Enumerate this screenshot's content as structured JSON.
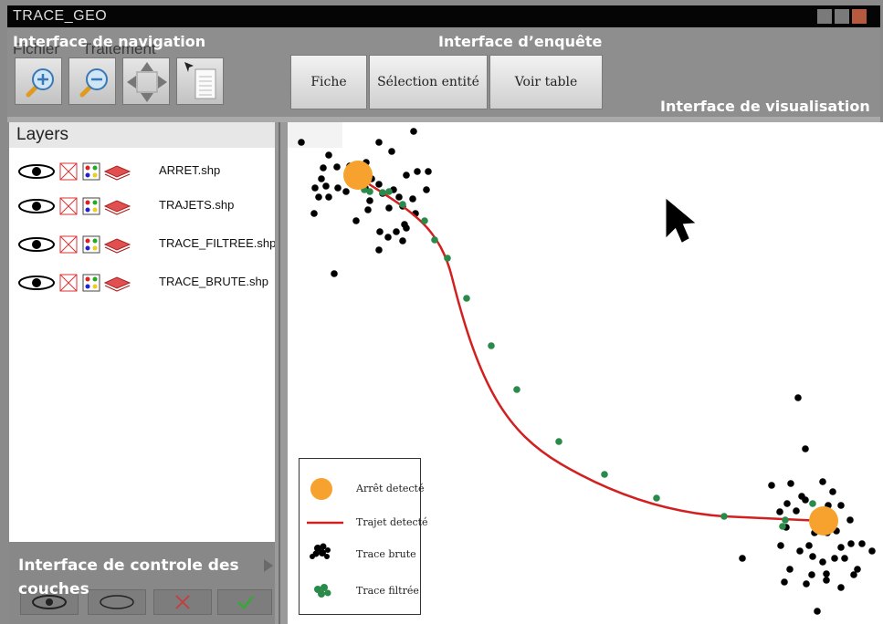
{
  "window": {
    "title": "TRACE_GEO"
  },
  "menu": {
    "fichier": "Fichier",
    "traitement": "Traitement"
  },
  "overlays": {
    "navigation": "Interface de navigation",
    "enquete": "Interface d’enquête",
    "visualisation": "Interface de visualisation",
    "controle_line1": "Interface de controle des",
    "controle_line2": "couches"
  },
  "toolbar": {
    "navigation_tools": [
      "zoom-in-icon",
      "zoom-out-icon",
      "pan-icon",
      "select-icon"
    ],
    "fiche": "Fiche",
    "selection": "Sélection entité",
    "voir_table": "Voir table"
  },
  "layers": {
    "title": "Layers",
    "items": [
      {
        "name": "ARRET.shp"
      },
      {
        "name": "TRAJETS.shp"
      },
      {
        "name": "TRACE_FILTREE.shp"
      },
      {
        "name": "TRACE_BRUTE.shp"
      }
    ]
  },
  "legend": {
    "arret": "Arrêt detecté",
    "trajet": "Trajet detecté",
    "brute": "Trace brute",
    "filtree": "Trace filtrée"
  },
  "colors": {
    "stop": "#f7a22e",
    "path": "#d22020",
    "raw": "#000000",
    "filtered": "#2a8a4a"
  }
}
